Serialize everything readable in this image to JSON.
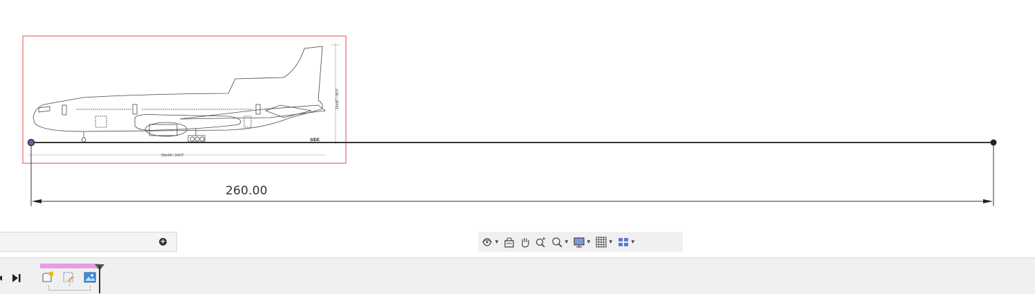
{
  "canvas": {
    "dimension_value": "260.00",
    "image_labels": {
      "length": "50m04 / 164'2\"",
      "height": "16m87 / 55'4\"",
      "view": "SIDE"
    }
  },
  "browser_panel": {
    "add_icon": "plus-circle-icon"
  },
  "nav_toolbar": {
    "tools": [
      {
        "icon": "orbit-icon",
        "dropdown": true
      },
      {
        "icon": "look-at-icon",
        "dropdown": false
      },
      {
        "icon": "pan-hand-icon",
        "dropdown": false
      },
      {
        "icon": "zoom-icon",
        "dropdown": false
      },
      {
        "icon": "fit-zoom-icon",
        "dropdown": true
      },
      {
        "icon": "display-settings-icon",
        "dropdown": true
      },
      {
        "icon": "grid-icon",
        "dropdown": true
      },
      {
        "icon": "viewports-icon",
        "dropdown": true
      }
    ]
  },
  "timeline": {
    "controls": [
      "step-back-icon",
      "go-to-end-icon"
    ],
    "features": [
      "sketch-feature-icon",
      "canvas-calibration-icon",
      "attached-canvas-icon"
    ],
    "accent_color": "#e69de6"
  }
}
